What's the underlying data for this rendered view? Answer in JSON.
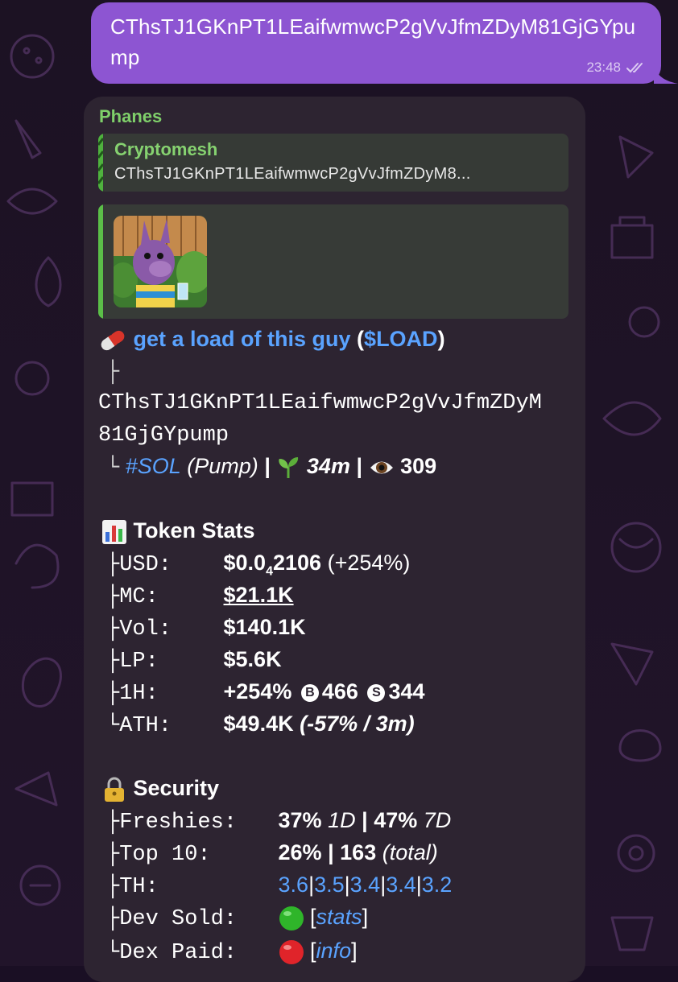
{
  "outgoing": {
    "text": "CThsTJ1GKnPT1LEaifwmwcP2gVvJfmZDyM81GjGYpump",
    "time": "23:48"
  },
  "incoming": {
    "sender": "Phanes",
    "reply": {
      "name": "Cryptomesh",
      "text": "CThsTJ1GKnPT1LEaifwmwcP2gVvJfmZDyM8..."
    },
    "token": {
      "name": "get a load of this guy",
      "symbol": "$LOAD",
      "branch": "├",
      "ca_line1": "CThsTJ1GKnPT1LEaifwmwcP2gVvJfmZDyM",
      "ca_line2": "81GjGYpump",
      "chain_tag": "#SOL",
      "platform": "(Pump)",
      "sep": "|",
      "age": "34m",
      "views": "309"
    },
    "stats": {
      "title": "Token Stats",
      "rows": [
        {
          "prefix": "├",
          "label": "USD:",
          "main": "$0.0",
          "sub": "4",
          "rest": "2106",
          "extra": "(+254%)"
        },
        {
          "prefix": "├",
          "label": "MC:",
          "value": "$21.1K"
        },
        {
          "prefix": "├",
          "label": "Vol:",
          "value": "$140.1K"
        },
        {
          "prefix": "├",
          "label": "LP:",
          "value": "$5.6K"
        },
        {
          "prefix": "├",
          "label": "1H:",
          "change": "+254%",
          "buy_icon": "B",
          "buys": "466",
          "sell_icon": "S",
          "sells": "344"
        },
        {
          "prefix": "└",
          "label": "ATH:",
          "value": "$49.4K",
          "extra": "(-57% / 3m)"
        }
      ]
    },
    "security": {
      "title": "Security",
      "freshies": {
        "prefix": "├",
        "label": "Freshies:",
        "v1": "37%",
        "p1": "1D",
        "sep": "|",
        "v2": "47%",
        "p2": "7D"
      },
      "top10": {
        "prefix": "├",
        "label": "Top 10:",
        "v1": "26%",
        "sep": "|",
        "v2": "163",
        "p2": "(total)"
      },
      "th": {
        "prefix": "├",
        "label": "TH:",
        "values": [
          "3.6",
          "3.5",
          "3.4",
          "3.4",
          "3.2"
        ],
        "sep": "|"
      },
      "dev_sold": {
        "prefix": "├",
        "label": "Dev Sold:",
        "status_color": "#2fb52a",
        "link": "stats"
      },
      "dex_paid": {
        "prefix": "└",
        "label": "Dex Paid:",
        "status_color": "#e0242a",
        "link": "info"
      }
    }
  }
}
